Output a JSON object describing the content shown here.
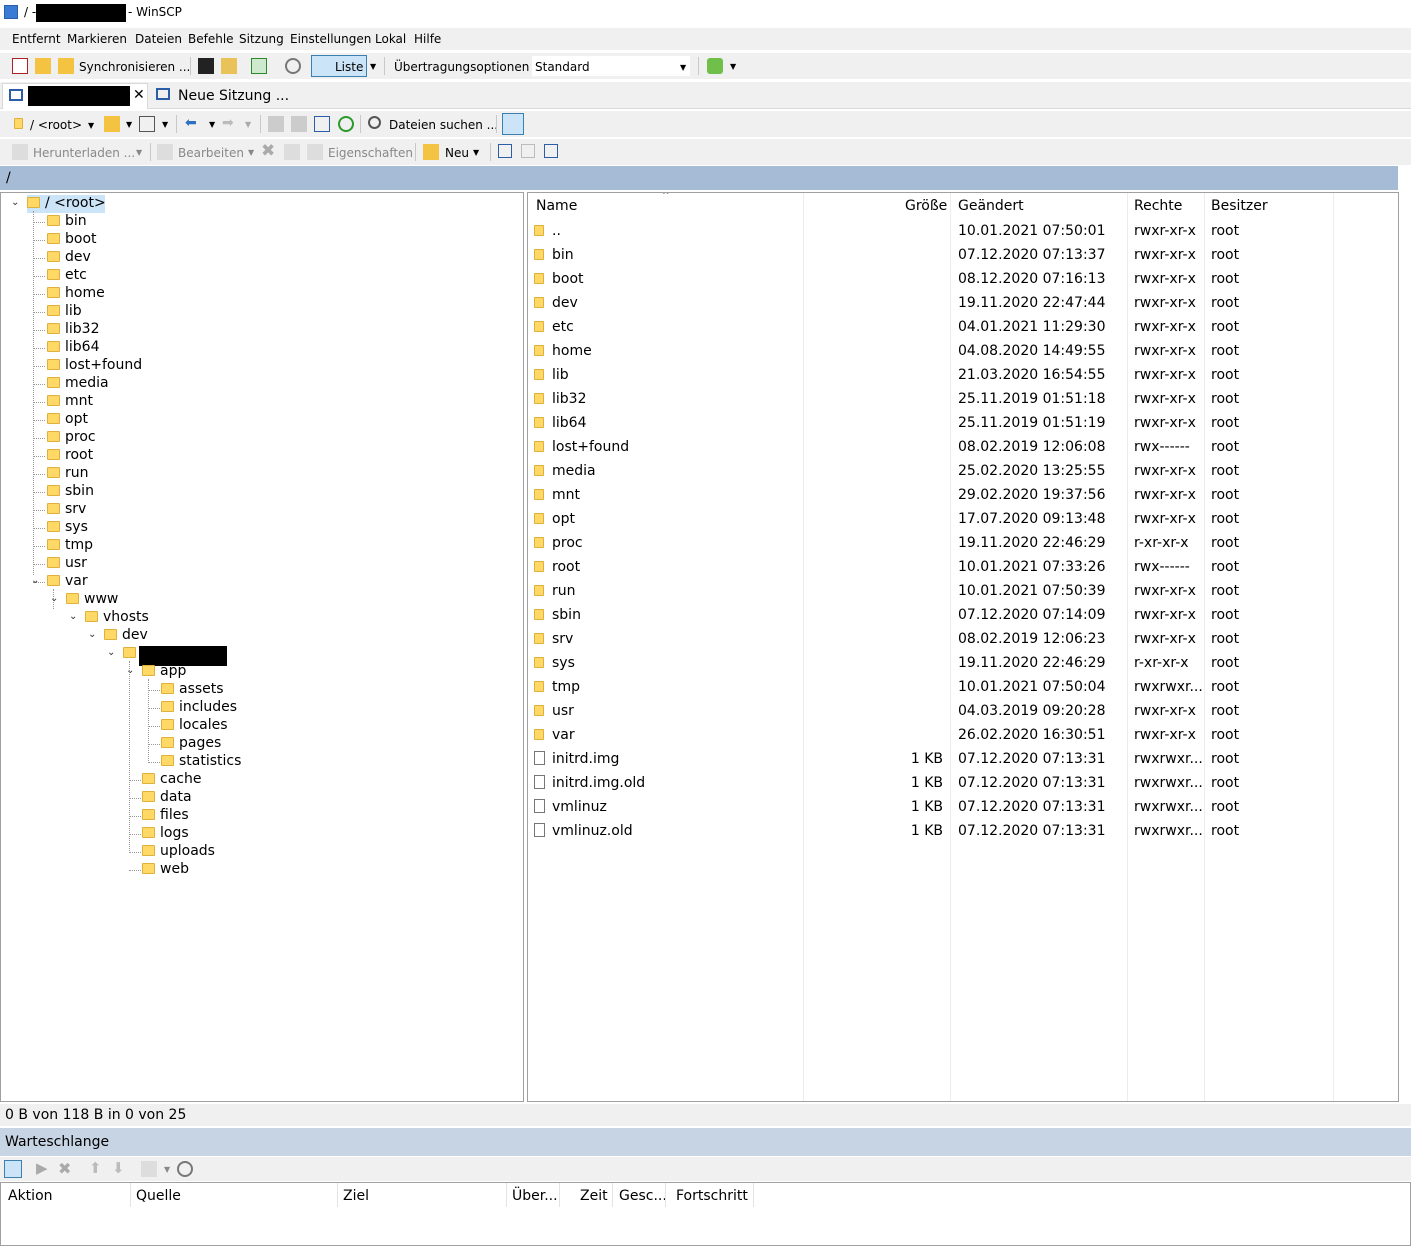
{
  "window": {
    "title_prefix": "/ -",
    "title_suffix": "- WinSCP"
  },
  "menu": [
    "Entfernt",
    "Markieren",
    "Dateien",
    "Befehle",
    "Sitzung",
    "Einstellungen",
    "Lokal",
    "Hilfe"
  ],
  "toolbar": {
    "synchronize": "Synchronisieren ...",
    "list": "Liste",
    "transfer_label": "Übertragungsoptionen",
    "transfer_value": "Standard"
  },
  "tabs": {
    "new_session": "Neue Sitzung ..."
  },
  "nav": {
    "path": "/ <root>",
    "find_files": "Dateien suchen ..."
  },
  "actions": {
    "download": "Herunterladen ...",
    "edit": "Bearbeiten",
    "properties": "Eigenschaften",
    "new": "Neu"
  },
  "current_path": "/",
  "tree": {
    "root": "/ <root>",
    "top": [
      "bin",
      "boot",
      "dev",
      "etc",
      "home",
      "lib",
      "lib32",
      "lib64",
      "lost+found",
      "media",
      "mnt",
      "opt",
      "proc",
      "root",
      "run",
      "sbin",
      "srv",
      "sys",
      "tmp",
      "usr",
      "var"
    ],
    "www": "www",
    "vhosts": "vhosts",
    "dev": "dev",
    "app": "app",
    "app_children": [
      "assets",
      "includes",
      "locales",
      "pages",
      "statistics"
    ],
    "site_children": [
      "cache",
      "data",
      "files",
      "logs",
      "uploads",
      "web"
    ]
  },
  "columns": {
    "name": "Name",
    "size": "Größe",
    "changed": "Geändert",
    "rights": "Rechte",
    "owner": "Besitzer"
  },
  "files": [
    {
      "name": "..",
      "size": "",
      "changed": "10.01.2021 07:50:01",
      "rights": "rwxr-xr-x",
      "owner": "root",
      "type": "up"
    },
    {
      "name": "bin",
      "size": "",
      "changed": "07.12.2020 07:13:37",
      "rights": "rwxr-xr-x",
      "owner": "root",
      "type": "dir"
    },
    {
      "name": "boot",
      "size": "",
      "changed": "08.12.2020 07:16:13",
      "rights": "rwxr-xr-x",
      "owner": "root",
      "type": "dir"
    },
    {
      "name": "dev",
      "size": "",
      "changed": "19.11.2020 22:47:44",
      "rights": "rwxr-xr-x",
      "owner": "root",
      "type": "dir"
    },
    {
      "name": "etc",
      "size": "",
      "changed": "04.01.2021 11:29:30",
      "rights": "rwxr-xr-x",
      "owner": "root",
      "type": "dir"
    },
    {
      "name": "home",
      "size": "",
      "changed": "04.08.2020 14:49:55",
      "rights": "rwxr-xr-x",
      "owner": "root",
      "type": "dir"
    },
    {
      "name": "lib",
      "size": "",
      "changed": "21.03.2020 16:54:55",
      "rights": "rwxr-xr-x",
      "owner": "root",
      "type": "dir"
    },
    {
      "name": "lib32",
      "size": "",
      "changed": "25.11.2019 01:51:18",
      "rights": "rwxr-xr-x",
      "owner": "root",
      "type": "dir"
    },
    {
      "name": "lib64",
      "size": "",
      "changed": "25.11.2019 01:51:19",
      "rights": "rwxr-xr-x",
      "owner": "root",
      "type": "dir"
    },
    {
      "name": "lost+found",
      "size": "",
      "changed": "08.02.2019 12:06:08",
      "rights": "rwx------",
      "owner": "root",
      "type": "dir"
    },
    {
      "name": "media",
      "size": "",
      "changed": "25.02.2020 13:25:55",
      "rights": "rwxr-xr-x",
      "owner": "root",
      "type": "dir"
    },
    {
      "name": "mnt",
      "size": "",
      "changed": "29.02.2020 19:37:56",
      "rights": "rwxr-xr-x",
      "owner": "root",
      "type": "dir"
    },
    {
      "name": "opt",
      "size": "",
      "changed": "17.07.2020 09:13:48",
      "rights": "rwxr-xr-x",
      "owner": "root",
      "type": "dir"
    },
    {
      "name": "proc",
      "size": "",
      "changed": "19.11.2020 22:46:29",
      "rights": "r-xr-xr-x",
      "owner": "root",
      "type": "dir"
    },
    {
      "name": "root",
      "size": "",
      "changed": "10.01.2021 07:33:26",
      "rights": "rwx------",
      "owner": "root",
      "type": "dir"
    },
    {
      "name": "run",
      "size": "",
      "changed": "10.01.2021 07:50:39",
      "rights": "rwxr-xr-x",
      "owner": "root",
      "type": "dir"
    },
    {
      "name": "sbin",
      "size": "",
      "changed": "07.12.2020 07:14:09",
      "rights": "rwxr-xr-x",
      "owner": "root",
      "type": "dir"
    },
    {
      "name": "srv",
      "size": "",
      "changed": "08.02.2019 12:06:23",
      "rights": "rwxr-xr-x",
      "owner": "root",
      "type": "dir"
    },
    {
      "name": "sys",
      "size": "",
      "changed": "19.11.2020 22:46:29",
      "rights": "r-xr-xr-x",
      "owner": "root",
      "type": "dir"
    },
    {
      "name": "tmp",
      "size": "",
      "changed": "10.01.2021 07:50:04",
      "rights": "rwxrwxr...",
      "owner": "root",
      "type": "dir"
    },
    {
      "name": "usr",
      "size": "",
      "changed": "04.03.2019 09:20:28",
      "rights": "rwxr-xr-x",
      "owner": "root",
      "type": "dir"
    },
    {
      "name": "var",
      "size": "",
      "changed": "26.02.2020 16:30:51",
      "rights": "rwxr-xr-x",
      "owner": "root",
      "type": "dir"
    },
    {
      "name": "initrd.img",
      "size": "1 KB",
      "changed": "07.12.2020 07:13:31",
      "rights": "rwxrwxr...",
      "owner": "root",
      "type": "link"
    },
    {
      "name": "initrd.img.old",
      "size": "1 KB",
      "changed": "07.12.2020 07:13:31",
      "rights": "rwxrwxr...",
      "owner": "root",
      "type": "link"
    },
    {
      "name": "vmlinuz",
      "size": "1 KB",
      "changed": "07.12.2020 07:13:31",
      "rights": "rwxrwxr...",
      "owner": "root",
      "type": "link"
    },
    {
      "name": "vmlinuz.old",
      "size": "1 KB",
      "changed": "07.12.2020 07:13:31",
      "rights": "rwxrwxr...",
      "owner": "root",
      "type": "link"
    }
  ],
  "status": "0 B von 118 B in 0 von 25",
  "queue": {
    "title": "Warteschlange",
    "columns": [
      "Aktion",
      "Quelle",
      "Ziel",
      "Über...",
      "Zeit",
      "Gesc...",
      "Fortschritt"
    ]
  },
  "colors": {
    "accent": "#a6bcd6",
    "folder": "#ffd865",
    "queue_header": "#c7d4e4"
  }
}
